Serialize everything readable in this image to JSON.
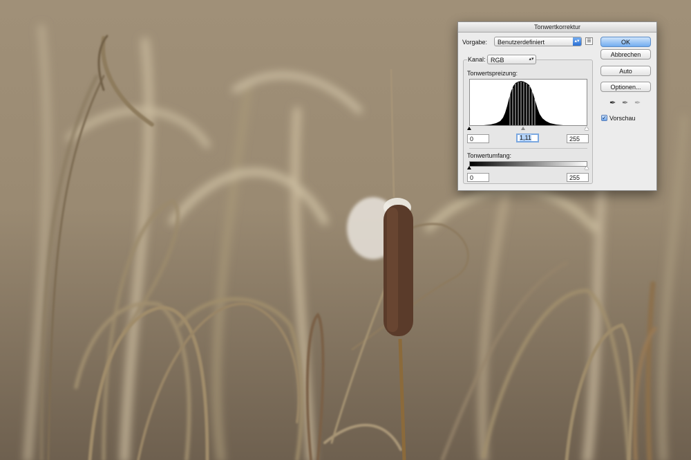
{
  "dialog": {
    "title": "Tonwertkorrektur",
    "preset_label": "Vorgabe:",
    "preset_value": "Benutzerdefiniert",
    "channel_label": "Kanal:",
    "channel_value": "RGB",
    "input_levels_label": "Tonwertspreizung:",
    "input_black": "0",
    "input_gamma": "1,11",
    "input_white": "255",
    "output_levels_label": "Tonwertumfang:",
    "output_black": "0",
    "output_white": "255",
    "buttons": {
      "ok": "OK",
      "cancel": "Abbrechen",
      "auto": "Auto",
      "options": "Optionen..."
    },
    "preview_label": "Vorschau",
    "preview_checked": true,
    "accent_color": "#3b82e0"
  },
  "icons": [
    "preset-menu-icon",
    "black-eyedropper-icon",
    "gray-eyedropper-icon",
    "white-eyedropper-icon",
    "checkmark-icon"
  ]
}
